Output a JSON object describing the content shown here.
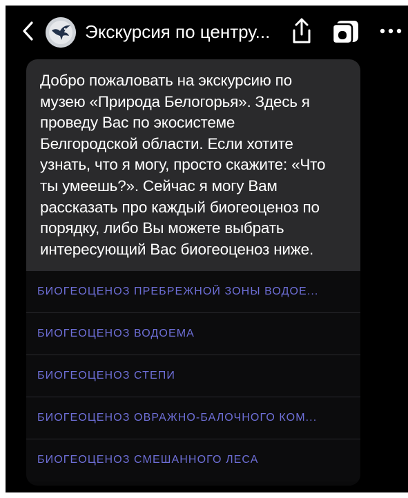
{
  "header": {
    "title": "Экскурсия по центру..."
  },
  "message": {
    "text": "Добро пожаловать на экскурсию по\nмузею «Природа Белогорья». Здесь я\nпроведу Вас по экосистеме\nБелгородской области. Если хотите\nузнать, что я могу, просто скажите: «Что\nты умеешь?». Сейчас я могу Вам\nрассказать про каждый биогеоценоз по\nпорядку, либо Вы можете выбрать\nинтересующий Вас биогеоценоз ниже."
  },
  "suggestions": [
    {
      "label": "БИОГЕОЦЕНОЗ ПРЕБРЕЖНОЙ ЗОНЫ ВОДОЕ..."
    },
    {
      "label": "БИОГЕОЦЕНОЗ ВОДОЕМА"
    },
    {
      "label": "БИОГЕОЦЕНОЗ СТЕПИ"
    },
    {
      "label": "БИОГЕОЦЕНОЗ ОВРАЖНО-БАЛОЧНОГО КОМ..."
    },
    {
      "label": "БИОГЕОЦЕНОЗ СМЕШАННОГО ЛЕСА"
    }
  ],
  "colors": {
    "background": "#000000",
    "message_bubble": "#2a2a2c",
    "suggestion_text": "#6e6fd8",
    "text": "#ffffff"
  },
  "icons": {
    "back": "chevron-left-icon",
    "avatar": "bird-avatar-icon",
    "share": "share-icon",
    "alice": "alice-icon",
    "more": "more-horizontal-icon"
  }
}
